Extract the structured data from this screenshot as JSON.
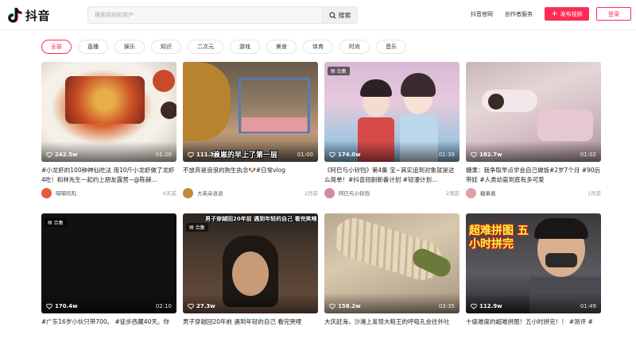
{
  "header": {
    "logo_text": "抖音",
    "search_placeholder": "搜索视频和用户",
    "search_label": "搜索",
    "nav_official": "抖音官网",
    "nav_creator": "创作者服务",
    "publish_label": "发布视频",
    "login_label": "登录"
  },
  "tabs": [
    {
      "label": "全部",
      "active": true
    },
    {
      "label": "直播"
    },
    {
      "label": "娱乐"
    },
    {
      "label": "知识"
    },
    {
      "label": "二次元"
    },
    {
      "label": "游戏"
    },
    {
      "label": "美食"
    },
    {
      "label": "体育"
    },
    {
      "label": "时尚"
    },
    {
      "label": "音乐"
    }
  ],
  "colors": {
    "brand": "#fe2c55"
  },
  "videos": [
    {
      "likes": "242.5w",
      "duration": "01:20",
      "title": "#小龙虾的100种神仙吃法 用10斤小龙虾做了龙虾4吃！和林先生一起约上朋友露营~@陈赫…",
      "author": "喵喵叽叽",
      "time": "6天前",
      "badge": "",
      "caption": ""
    },
    {
      "likes": "111.3w",
      "duration": "01:00",
      "title": "不放弃是浪浪的狗生执念🐶#日常vlog",
      "author": "大英朵浪浪",
      "time": "2月前",
      "badge": "",
      "caption": "浪崽的早上了第一层"
    },
    {
      "likes": "174.0w",
      "duration": "01:39",
      "title": "《阿巳与小铃铛》第4集 宝~其实追到对象就是这么简单！#抖音短剧新番计划 #轻漫计划…",
      "author": "阿巳与小铃铛",
      "time": "2周前",
      "badge": "合集",
      "caption": ""
    },
    {
      "likes": "182.7w",
      "duration": "01:02",
      "title": "糖果：我争取早点学会自己做饭#2岁7个月 #90后带娃 #人类幼崽到底有多可爱",
      "author": "糖果酱",
      "time": "1月前",
      "badge": "",
      "caption": ""
    },
    {
      "likes": "170.4w",
      "duration": "02:10",
      "title": "#广东16岁小伙只带700。 #徒步西藏40天。你",
      "author": "",
      "time": "",
      "badge": "合集",
      "caption": ""
    },
    {
      "likes": "27.3w",
      "duration": "",
      "title": "男子穿越回20年前 遇到年轻的自己 看完哭哩",
      "author": "",
      "time": "",
      "badge": "合集",
      "caption": "男子穿越回20年前 遇到年轻的自己 看完笑哩"
    },
    {
      "likes": "158.2w",
      "duration": "03:35",
      "title": "大庆赶海，沙滩上发现大鲑王的呼吸孔会往外吐",
      "author": "",
      "time": "",
      "badge": "",
      "caption": ""
    },
    {
      "likes": "112.9w",
      "duration": "01:49",
      "title": "十级难度的超难拼图！五小时拼完！！ #测评 #",
      "author": "",
      "time": "",
      "badge": "",
      "caption": "超难拼图 五小时拼完"
    }
  ]
}
